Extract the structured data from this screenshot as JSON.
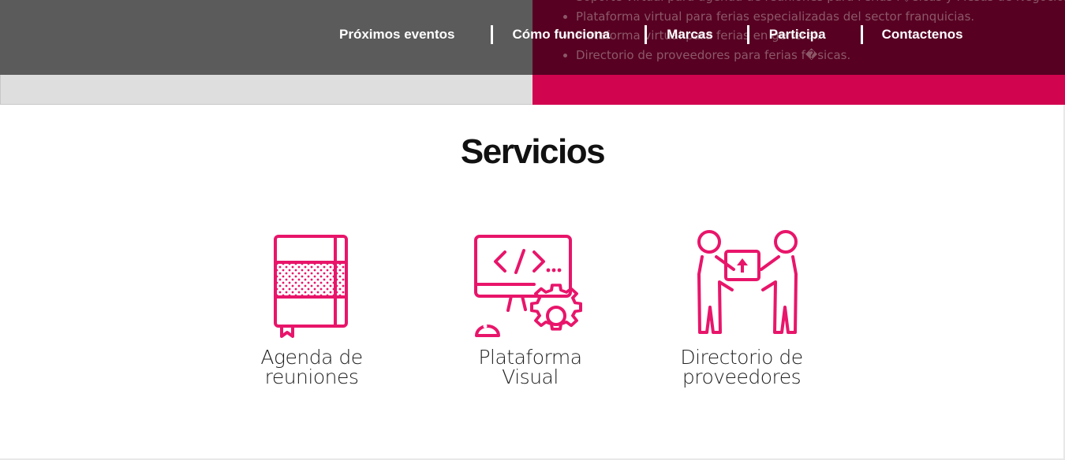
{
  "hero": {
    "bullets": [
      "Soporte virtual para agenda de reuniones para Ferias f�sicas y Mesas de Negocios.",
      "Plataforma virtual para ferias especializadas del sector franquicias.",
      "Plataforma virtual para ferias en general.",
      "Directorio de proveedores para ferias f�sicas."
    ]
  },
  "nav": {
    "items": [
      "Próximos eventos",
      "Cómo funciona",
      "Marcas",
      "Participa",
      "Contactenos"
    ]
  },
  "services": {
    "title": "Servicios",
    "items": [
      {
        "label": "Agenda de\nreuniones",
        "icon": "notebook-icon"
      },
      {
        "label": "Plataforma\nVisual",
        "icon": "code-monitor-icon"
      },
      {
        "label": "Directorio de\nproveedores",
        "icon": "people-exchange-box-icon"
      }
    ]
  },
  "colors": {
    "accent": "#e8156a",
    "dark_panel": "#570022",
    "gray_panel": "#5b5b5b",
    "pink_band": "#d1044f"
  }
}
